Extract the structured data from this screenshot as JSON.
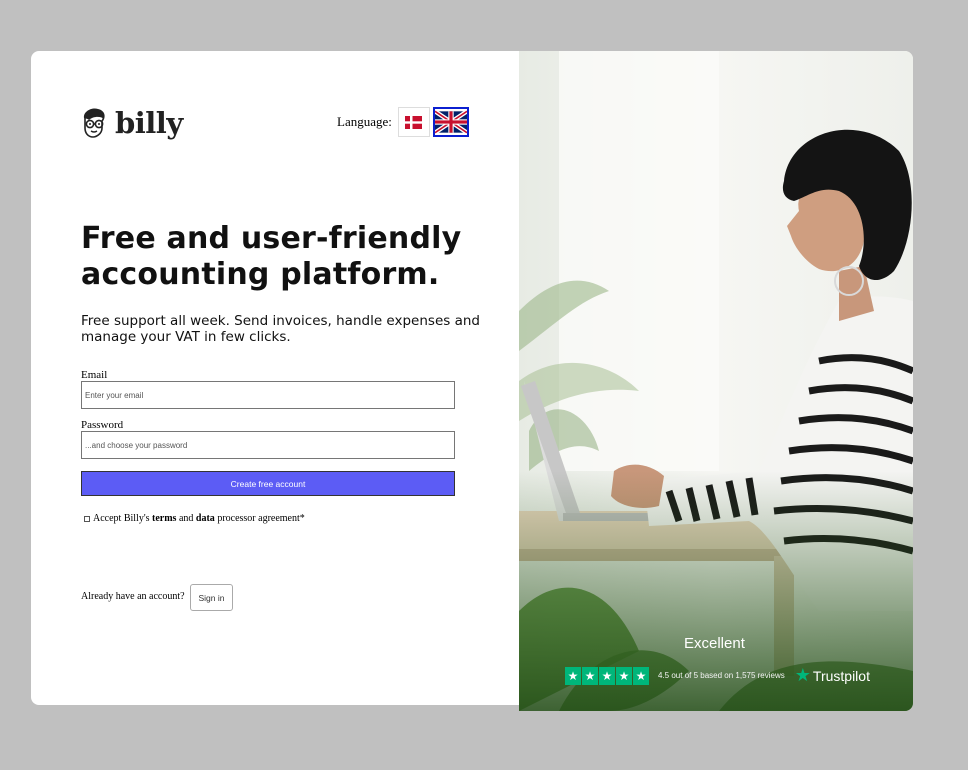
{
  "brand": {
    "name": "billy"
  },
  "language": {
    "label": "Language:"
  },
  "hero": {
    "headline": "Free and user-friendly accounting platform.",
    "subtitle": "Free support all week. Send invoices, handle expenses and manage your VAT in few clicks."
  },
  "form": {
    "email_label": "Email",
    "email_placeholder": "Enter your email",
    "password_label": "Password",
    "password_placeholder": "...and choose your password",
    "submit_label": "Create free account",
    "accept_prefix": "Accept Billy's",
    "accept_terms": "terms",
    "accept_and": "and",
    "accept_data": "data",
    "accept_suffix": "processor agreement*"
  },
  "signin": {
    "prompt": "Already have an account?",
    "button_label": "Sign in"
  },
  "trustpilot": {
    "rating_word": "Excellent",
    "summary": "4.5 out of 5 based on 1,575 reviews",
    "brand": "Trustpilot",
    "stars": 5
  },
  "colors": {
    "primary": "#5c5cf5",
    "trustpilot_green": "#00b67a",
    "backdrop": "#c0c0c0"
  }
}
